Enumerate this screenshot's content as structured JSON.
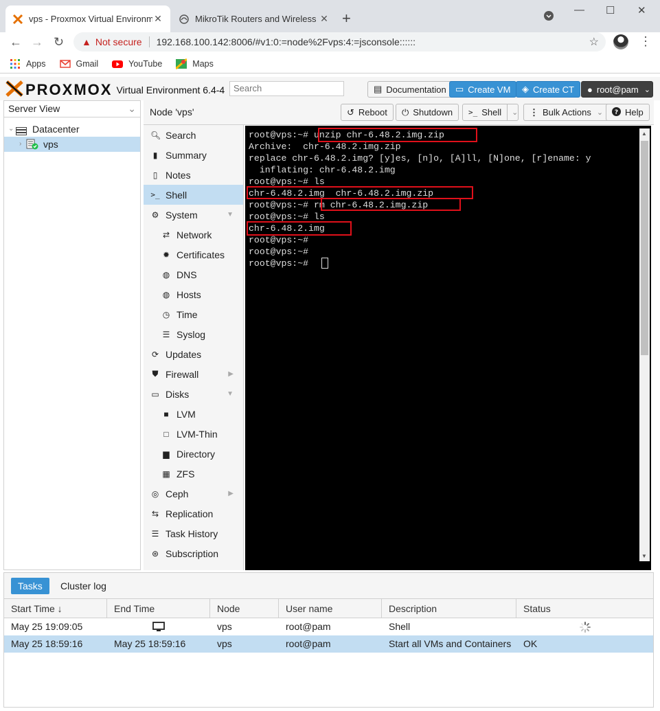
{
  "browser": {
    "tabs": [
      {
        "title": "vps - Proxmox Virtual Environme",
        "close": "✕"
      },
      {
        "title": "MikroTik Routers and Wireless - S",
        "close": "✕"
      }
    ],
    "new_tab": "+",
    "address": {
      "security_label": "Not secure",
      "url": "192.168.100.142:8006/#v1:0:=node%2Fvps:4:=jsconsole::::::"
    },
    "bookmarks": [
      {
        "label": "Apps",
        "icon": "apps-grid-icon"
      },
      {
        "label": "Gmail",
        "icon": "gmail-icon"
      },
      {
        "label": "YouTube",
        "icon": "youtube-icon"
      },
      {
        "label": "Maps",
        "icon": "maps-icon"
      }
    ]
  },
  "pve": {
    "brand": "PROXMOX",
    "product": "Virtual Environment 6.4-4",
    "search_placeholder": "Search",
    "header_buttons": {
      "documentation": "Documentation",
      "create_vm": "Create VM",
      "create_ct": "Create CT",
      "user": "root@pam"
    },
    "view_selector": "Server View",
    "tree": {
      "datacenter": "Datacenter",
      "node": "vps"
    },
    "node_title": "Node 'vps'",
    "node_toolbar": {
      "reboot": "Reboot",
      "shutdown": "Shutdown",
      "shell": "Shell",
      "bulk_actions": "Bulk Actions",
      "help": "Help"
    },
    "menu": [
      {
        "label": "Search",
        "icon": "search-icon"
      },
      {
        "label": "Summary",
        "icon": "book-icon"
      },
      {
        "label": "Notes",
        "icon": "notes-icon"
      },
      {
        "label": "Shell",
        "icon": "terminal-icon"
      },
      {
        "label": "System",
        "icon": "cogs-icon"
      },
      {
        "label": "Network",
        "icon": "exchange-icon"
      },
      {
        "label": "Certificates",
        "icon": "certificate-icon"
      },
      {
        "label": "DNS",
        "icon": "globe-icon"
      },
      {
        "label": "Hosts",
        "icon": "globe-icon"
      },
      {
        "label": "Time",
        "icon": "clock-icon"
      },
      {
        "label": "Syslog",
        "icon": "list-icon"
      },
      {
        "label": "Updates",
        "icon": "refresh-icon"
      },
      {
        "label": "Firewall",
        "icon": "shield-icon"
      },
      {
        "label": "Disks",
        "icon": "hdd-icon"
      },
      {
        "label": "LVM",
        "icon": "square-icon"
      },
      {
        "label": "LVM-Thin",
        "icon": "square-outline-icon"
      },
      {
        "label": "Directory",
        "icon": "folder-icon"
      },
      {
        "label": "ZFS",
        "icon": "th-large-icon"
      },
      {
        "label": "Ceph",
        "icon": "ceph-icon"
      },
      {
        "label": "Replication",
        "icon": "retweet-icon"
      },
      {
        "label": "Task History",
        "icon": "list-alt-icon"
      },
      {
        "label": "Subscription",
        "icon": "support-icon"
      }
    ],
    "terminal": {
      "lines": [
        "root@vps:~# unzip chr-6.48.2.img.zip",
        "Archive:  chr-6.48.2.img.zip",
        "replace chr-6.48.2.img? [y]es, [n]o, [A]ll, [N]one, [r]ename: y",
        "  inflating: chr-6.48.2.img",
        "root@vps:~# ls",
        "chr-6.48.2.img  chr-6.48.2.img.zip",
        "root@vps:~# rm chr-6.48.2.img.zip",
        "root@vps:~# ls",
        "chr-6.48.2.img",
        "root@vps:~#",
        "root@vps:~#",
        "root@vps:~# "
      ]
    },
    "bottom": {
      "tabs": [
        "Tasks",
        "Cluster log"
      ],
      "columns": [
        "Start Time ↓",
        "End Time",
        "Node",
        "User name",
        "Description",
        "Status"
      ],
      "rows": [
        {
          "start": "May 25 19:09:05",
          "end": "",
          "node": "vps",
          "user": "root@pam",
          "desc": "Shell",
          "status": ""
        },
        {
          "start": "May 25 18:59:16",
          "end": "May 25 18:59:16",
          "node": "vps",
          "user": "root@pam",
          "desc": "Start all VMs and Containers",
          "status": "OK"
        }
      ]
    }
  }
}
